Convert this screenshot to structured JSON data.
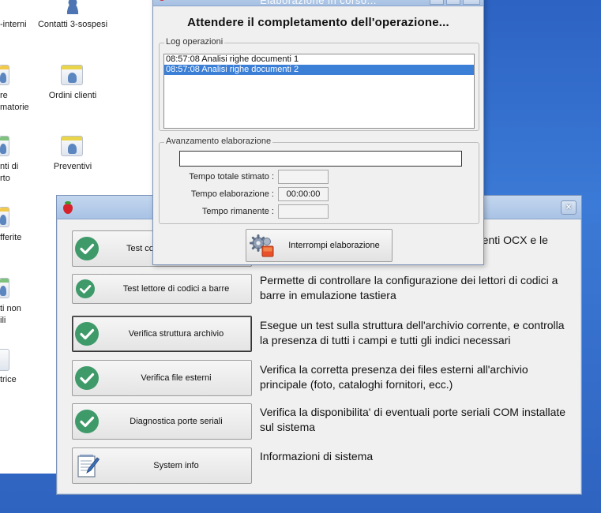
{
  "desktop": {
    "icons": [
      {
        "label": "-interni",
        "icon": "contacts-icon"
      },
      {
        "label": "Contatti 3-sospesi",
        "icon": "contact-person-icon"
      },
      {
        "label": "re\nmatorie",
        "icon": "document-people-icon"
      },
      {
        "label": "Ordini clienti",
        "icon": "orders-people-icon"
      },
      {
        "label": "nti di\nrto",
        "icon": "document-green-icon"
      },
      {
        "label": "Preventivi",
        "icon": "quotes-people-icon"
      },
      {
        "label": "fferite",
        "icon": "document-yellow-icon"
      },
      {
        "label": "ti non\nili",
        "icon": "document-green-icon"
      },
      {
        "label": "trice",
        "icon": "document-plain-icon"
      }
    ]
  },
  "diagnostics": {
    "close_label": "×",
    "items": [
      {
        "button": "Test co",
        "description": "...menti OCX e le",
        "icon": "check-icon"
      },
      {
        "button": "Test lettore di codici a barre",
        "description": "Permette di controllare la configurazione dei lettori di codici a barre in emulazione tastiera",
        "icon": "check-icon"
      },
      {
        "button": "Verifica struttura archivio",
        "description": "Esegue un test sulla struttura dell'archivio corrente, e controlla la presenza di tutti i campi e tutti gli indici necessari",
        "icon": "check-icon"
      },
      {
        "button": "Verifica file esterni",
        "description": "Verifica la corretta presenza dei files esterni all'archivio principale (foto, cataloghi fornitori, ecc.)",
        "icon": "check-icon"
      },
      {
        "button": "Diagnostica porte seriali",
        "description": "Verifica la disponibilita' di eventuali porte seriali COM installate sul sistema",
        "icon": "check-icon"
      },
      {
        "button": "System info",
        "description": "Informazioni di sistema",
        "icon": "notepad-icon"
      }
    ],
    "partial_description": "menti OCX e le"
  },
  "progress_dialog": {
    "title": "Elaborazione in corso...",
    "heading": "Attendere il completamento dell'operazione...",
    "log_group_label": "Log operazioni",
    "log_entries": [
      {
        "text": "08:57:08 Analisi righe documenti 1",
        "selected": false
      },
      {
        "text": "08:57:08 Analisi righe documenti 2",
        "selected": true
      }
    ],
    "progress_group_label": "Avanzamento elaborazione",
    "progress_value": 0,
    "time_total_label": "Tempo totale stimato :",
    "time_total_value": "",
    "time_elapsed_label": "Tempo elaborazione :",
    "time_elapsed_value": "00:00:00",
    "time_remaining_label": "Tempo rimanente :",
    "time_remaining_value": "",
    "stop_label": "Interrompi elaborazione"
  }
}
